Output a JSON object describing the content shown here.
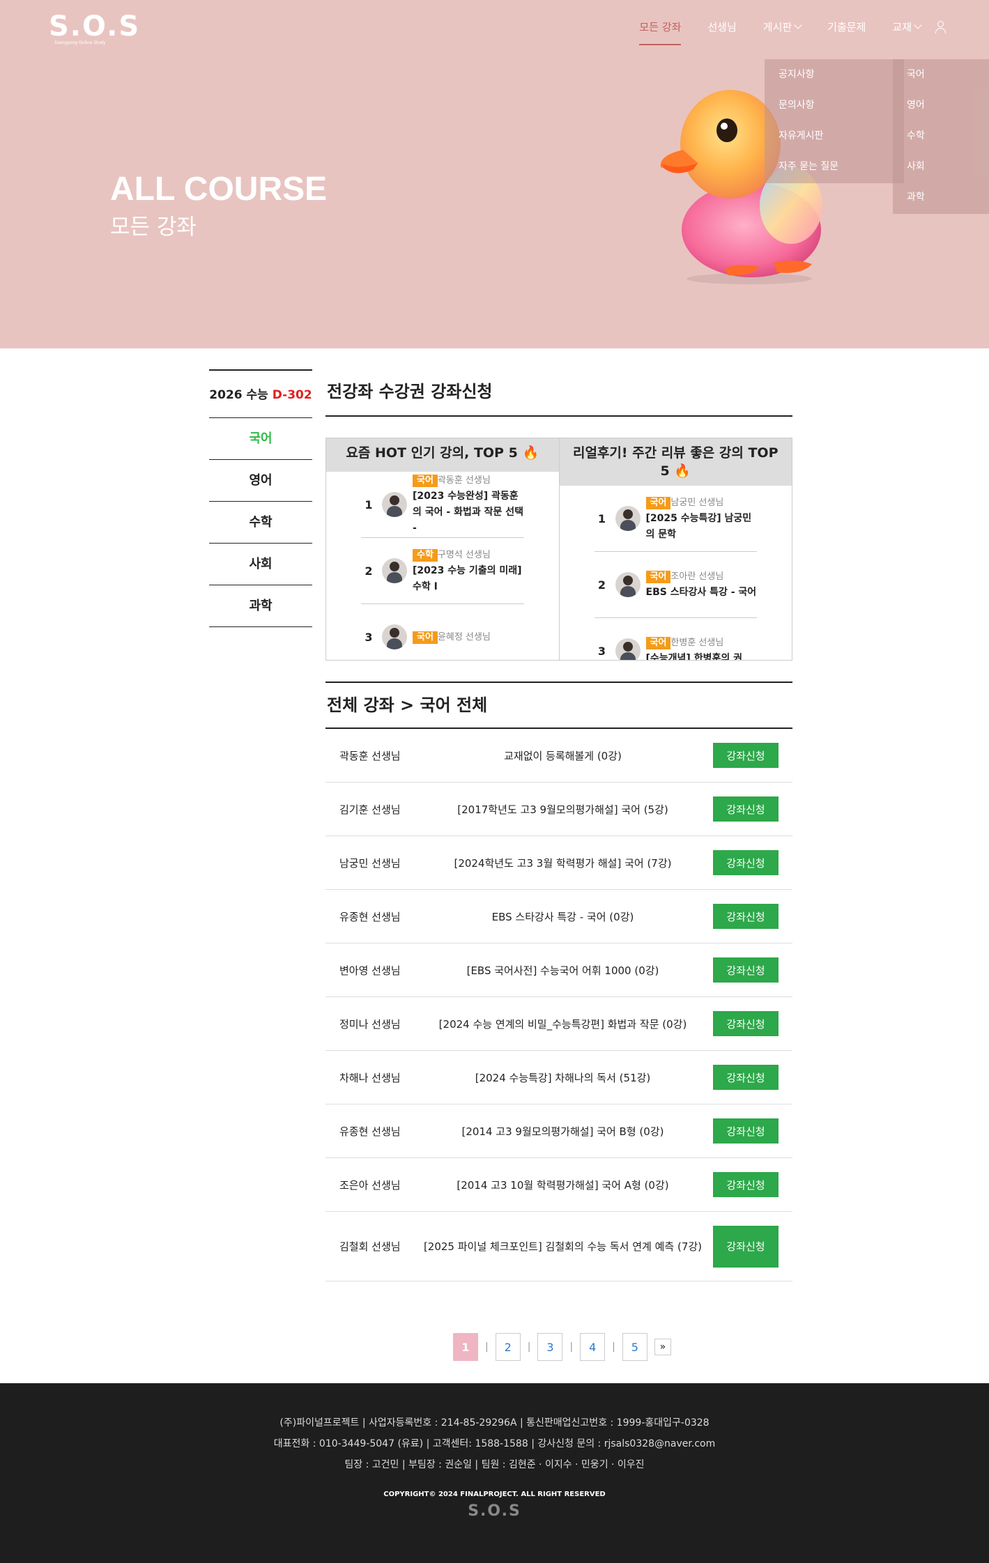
{
  "logo": {
    "text": "S.O.S",
    "sub": "Ssangyong Online Study"
  },
  "nav": {
    "items": [
      "모든 강좌",
      "선생님",
      "게시판",
      "기출문제",
      "교재"
    ],
    "board_menu": [
      "공지사항",
      "문의사항",
      "자유게시판",
      "자주 묻는 질문"
    ],
    "book_menu": [
      "국어",
      "영어",
      "수학",
      "사회",
      "과학"
    ]
  },
  "hero": {
    "title": "ALL COURSE",
    "subtitle": "모든 강좌"
  },
  "sidebar": {
    "dday_prefix": "2026 수능",
    "dday": "D-302",
    "items": [
      "국어",
      "영어",
      "수학",
      "사회",
      "과학"
    ]
  },
  "main": {
    "section_title": "전강좌 수강권 강좌신청",
    "hot_title": "요즘 HOT 인기 강의, TOP 5",
    "review_title": "리얼후기! 주간 리뷰 좋은 강의 TOP 5",
    "hot_list": [
      {
        "rank": "1",
        "subject": "국어",
        "teacher": "곽동훈 선생님",
        "title": "[2023 수능완성] 곽동훈의 국어 - 화법과 작문 선택 -"
      },
      {
        "rank": "2",
        "subject": "수학",
        "teacher": "구명석 선생님",
        "title": "[2023 수능 기출의 미래] 수학 I"
      },
      {
        "rank": "3",
        "subject": "국어",
        "teacher": "윤혜정 선생님",
        "title": ""
      }
    ],
    "review_list": [
      {
        "rank": "1",
        "subject": "국어",
        "teacher": "남궁민 선생님",
        "title": "[2025 수능특강] 남궁민의 문학"
      },
      {
        "rank": "2",
        "subject": "국어",
        "teacher": "조아란 선생님",
        "title": "EBS 스타강사 특강 - 국어"
      },
      {
        "rank": "3",
        "subject": "국어",
        "teacher": "한병훈 선생님",
        "title": "[수능개념] 한병훈의 권"
      }
    ],
    "list_title": "전체 강좌 > 국어 전체",
    "apply_label": "강좌신청",
    "courses": [
      {
        "teacher": "곽동훈 선생님",
        "title": "교재없이 등록해볼게 (0강)"
      },
      {
        "teacher": "김기훈 선생님",
        "title": "[2017학년도 고3 9월모의평가해설] 국어 (5강)"
      },
      {
        "teacher": "남궁민 선생님",
        "title": "[2024학년도 고3 3월 학력평가 해설] 국어 (7강)"
      },
      {
        "teacher": "유종현 선생님",
        "title": "EBS 스타강사 특강 - 국어 (0강)"
      },
      {
        "teacher": "변아영 선생님",
        "title": "[EBS 국어사전] 수능국어 어휘 1000 (0강)"
      },
      {
        "teacher": "정미나 선생님",
        "title": "[2024 수능 연계의 비밀_수능특강편] 화법과 작문 (0강)"
      },
      {
        "teacher": "차해나 선생님",
        "title": "[2024 수능특강] 차해나의 독서 (51강)"
      },
      {
        "teacher": "유종현 선생님",
        "title": "[2014 고3 9월모의평가해설] 국어 B형 (0강)"
      },
      {
        "teacher": "조은아 선생님",
        "title": "[2014 고3 10월 학력평가해설] 국어 A형 (0강)"
      },
      {
        "teacher": "김철회 선생님",
        "title": "[2025 파이널 체크포인트] 김철회의 수능 독서 연계 예측 (7강)"
      }
    ]
  },
  "pager": {
    "pages": [
      "1",
      "2",
      "3",
      "4",
      "5"
    ],
    "next": "»"
  },
  "footer": {
    "line1": "(주)파이널프로젝트 | 사업자등록번호 : 214-85-29296A | 통신판매업신고번호 : 1999-홍대입구-0328",
    "line2": "대표전화 : 010-3449-5047 (유료) | 고객센터: 1588-1588 | 강사신청 문의 : rjsals0328@naver.com",
    "line3": "팀장 : 고건민  |  부팀장 : 권순일  |  팀원 : 김현준 · 이지수 · 민웅기 · 이우진",
    "copyright": "COPYRIGHT© 2024 FINALPROJECT. ALL RIGHT RESERVED",
    "logo": "S.O.S"
  }
}
